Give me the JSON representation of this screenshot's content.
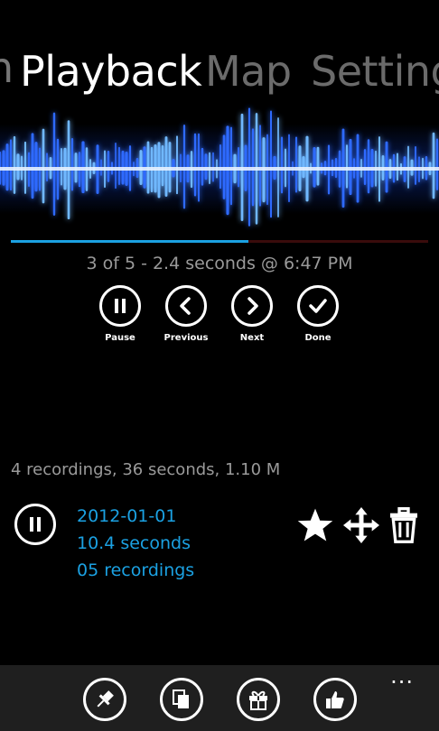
{
  "pivot": {
    "prev_tab_fragment": "n",
    "tabs": [
      {
        "label": "Playback",
        "active": true
      },
      {
        "label": "Map",
        "active": false
      },
      {
        "label": "Setting",
        "active": false
      }
    ]
  },
  "playback": {
    "progress_fraction": 0.57,
    "status": "3 of 5 - 2.4 seconds  @ 6:47 PM",
    "controls": [
      {
        "label": "Pause",
        "icon": "pause-icon"
      },
      {
        "label": "Previous",
        "icon": "chevron-left-icon"
      },
      {
        "label": "Next",
        "icon": "chevron-right-icon"
      },
      {
        "label": "Done",
        "icon": "check-icon"
      }
    ]
  },
  "summary": "4 recordings, 36 seconds,  1.10 M",
  "recording": {
    "date": "2012-01-01",
    "duration": "10.4 seconds",
    "count": "05 recordings",
    "icons": [
      "pause-icon",
      "star-icon",
      "move-icon",
      "trash-icon"
    ]
  },
  "appbar": {
    "icons": [
      "pin-icon",
      "copy-icon",
      "gift-icon",
      "thumbs-up-icon"
    ],
    "more": "..."
  },
  "colors": {
    "accent": "#1ba1e2",
    "background": "#000000",
    "appbar": "#1f1f1f",
    "muted": "#9a9a9a"
  }
}
